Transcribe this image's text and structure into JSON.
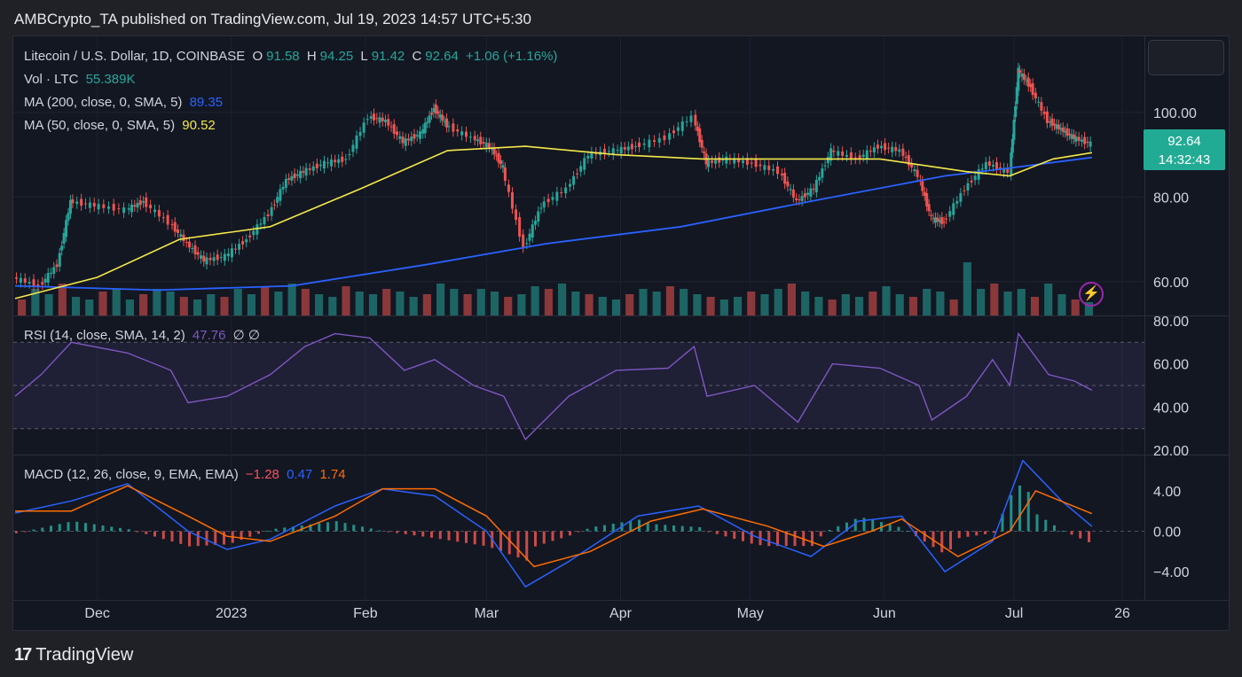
{
  "header": {
    "publisher_line": "AMBCrypto_TA published on TradingView.com, Jul 19, 2023 14:57 UTC+5:30"
  },
  "legend": {
    "symbol": "Litecoin / U.S. Dollar, 1D, COINBASE",
    "o_label": "O",
    "o_value": "91.58",
    "h_label": "H",
    "h_value": "94.25",
    "l_label": "L",
    "l_value": "91.42",
    "c_label": "C",
    "c_value": "92.64",
    "change": "+1.06 (+1.16%)",
    "vol_label": "Vol · LTC",
    "vol_value": "55.389K",
    "ma200_label": "MA (200, close, 0, SMA, 5)",
    "ma200_value": "89.35",
    "ma50_label": "MA (50, close, 0, SMA, 5)",
    "ma50_value": "90.52",
    "rsi_label": "RSI (14, close, SMA, 14, 2)",
    "rsi_value": "47.76",
    "rsi_extra": "∅ ∅",
    "macd_label": "MACD (12, 26, close, 9, EMA, EMA)",
    "macd_hist": "−1.28",
    "macd_value": "0.47",
    "macd_signal": "1.74"
  },
  "price_tag": {
    "price": "92.64",
    "countdown": "14:32:43"
  },
  "colors": {
    "up": "#26a69a",
    "down": "#ef5350",
    "ma200": "#2962ff",
    "ma50": "#f5e94a",
    "rsi": "#7e57c2",
    "macd": "#2962ff",
    "signal": "#ff6d00"
  },
  "footer": {
    "brand": "TradingView"
  },
  "chart_data": {
    "type": "line",
    "x_labels": [
      "Dec",
      "2023",
      "Feb",
      "Mar",
      "Apr",
      "May",
      "Jun",
      "Jul",
      "26"
    ],
    "price_axis": {
      "ticks": [
        "60.00",
        "80.00",
        "100.00"
      ],
      "ylim": [
        52,
        118
      ]
    },
    "rsi_axis": {
      "ticks": [
        "20.00",
        "40.00",
        "60.00",
        "80.00"
      ],
      "bands": [
        30,
        70
      ],
      "mid": 50
    },
    "macd_axis": {
      "ticks": [
        "−4.00",
        "0.00",
        "4.00"
      ]
    },
    "price_series": [
      [
        "2022-11-12",
        61
      ],
      [
        "2022-11-18",
        59
      ],
      [
        "2022-11-22",
        64
      ],
      [
        "2022-11-25",
        79
      ],
      [
        "2022-12-01",
        78
      ],
      [
        "2022-12-08",
        77
      ],
      [
        "2022-12-12",
        79
      ],
      [
        "2022-12-18",
        74
      ],
      [
        "2022-12-22",
        69
      ],
      [
        "2022-12-26",
        65
      ],
      [
        "2022-12-31",
        66
      ],
      [
        "2023-01-05",
        70
      ],
      [
        "2023-01-10",
        76
      ],
      [
        "2023-01-14",
        84
      ],
      [
        "2023-01-18",
        86
      ],
      [
        "2023-01-23",
        88
      ],
      [
        "2023-01-28",
        89
      ],
      [
        "2023-02-02",
        99
      ],
      [
        "2023-02-06",
        98
      ],
      [
        "2023-02-10",
        93
      ],
      [
        "2023-02-14",
        95
      ],
      [
        "2023-02-17",
        101
      ],
      [
        "2023-02-20",
        97
      ],
      [
        "2023-02-26",
        94
      ],
      [
        "2023-03-02",
        92
      ],
      [
        "2023-03-05",
        87
      ],
      [
        "2023-03-10",
        68
      ],
      [
        "2023-03-14",
        78
      ],
      [
        "2023-03-20",
        82
      ],
      [
        "2023-03-25",
        90
      ],
      [
        "2023-03-31",
        91
      ],
      [
        "2023-04-05",
        92
      ],
      [
        "2023-04-12",
        94
      ],
      [
        "2023-04-18",
        99
      ],
      [
        "2023-04-21",
        88
      ],
      [
        "2023-04-26",
        89
      ],
      [
        "2023-05-02",
        88
      ],
      [
        "2023-05-08",
        86
      ],
      [
        "2023-05-12",
        79
      ],
      [
        "2023-05-16",
        82
      ],
      [
        "2023-05-20",
        91
      ],
      [
        "2023-05-26",
        89
      ],
      [
        "2023-05-31",
        92
      ],
      [
        "2023-06-05",
        91
      ],
      [
        "2023-06-09",
        85
      ],
      [
        "2023-06-12",
        75
      ],
      [
        "2023-06-15",
        74
      ],
      [
        "2023-06-20",
        82
      ],
      [
        "2023-06-25",
        88
      ],
      [
        "2023-06-30",
        86
      ],
      [
        "2023-07-02",
        110
      ],
      [
        "2023-07-05",
        106
      ],
      [
        "2023-07-09",
        98
      ],
      [
        "2023-07-12",
        96
      ],
      [
        "2023-07-15",
        94
      ],
      [
        "2023-07-19",
        92.6
      ]
    ],
    "ma50_series": [
      [
        "2022-11-12",
        56
      ],
      [
        "2022-12-01",
        61
      ],
      [
        "2022-12-20",
        70
      ],
      [
        "2023-01-10",
        73
      ],
      [
        "2023-01-31",
        82
      ],
      [
        "2023-02-20",
        91
      ],
      [
        "2023-03-10",
        92
      ],
      [
        "2023-03-31",
        90
      ],
      [
        "2023-04-20",
        89
      ],
      [
        "2023-05-10",
        89
      ],
      [
        "2023-05-31",
        89
      ],
      [
        "2023-06-20",
        86
      ],
      [
        "2023-06-30",
        85
      ],
      [
        "2023-07-10",
        89
      ],
      [
        "2023-07-19",
        90.5
      ]
    ],
    "ma200_series": [
      [
        "2022-11-12",
        59
      ],
      [
        "2022-12-15",
        58
      ],
      [
        "2023-01-15",
        59
      ],
      [
        "2023-02-15",
        64
      ],
      [
        "2023-03-15",
        69
      ],
      [
        "2023-04-15",
        73
      ],
      [
        "2023-05-15",
        79
      ],
      [
        "2023-06-15",
        85
      ],
      [
        "2023-07-01",
        87
      ],
      [
        "2023-07-19",
        89.35
      ]
    ],
    "rsi_series": [
      [
        "2022-11-12",
        45
      ],
      [
        "2022-11-18",
        55
      ],
      [
        "2022-11-25",
        70
      ],
      [
        "2022-12-08",
        65
      ],
      [
        "2022-12-18",
        57
      ],
      [
        "2022-12-22",
        42
      ],
      [
        "2022-12-31",
        45
      ],
      [
        "2023-01-10",
        55
      ],
      [
        "2023-01-18",
        68
      ],
      [
        "2023-01-25",
        74
      ],
      [
        "2023-02-02",
        72
      ],
      [
        "2023-02-10",
        57
      ],
      [
        "2023-02-17",
        62
      ],
      [
        "2023-02-26",
        50
      ],
      [
        "2023-03-05",
        45
      ],
      [
        "2023-03-10",
        25
      ],
      [
        "2023-03-20",
        45
      ],
      [
        "2023-03-31",
        57
      ],
      [
        "2023-04-12",
        58
      ],
      [
        "2023-04-18",
        68
      ],
      [
        "2023-04-21",
        45
      ],
      [
        "2023-05-02",
        50
      ],
      [
        "2023-05-12",
        33
      ],
      [
        "2023-05-20",
        60
      ],
      [
        "2023-05-31",
        58
      ],
      [
        "2023-06-09",
        50
      ],
      [
        "2023-06-12",
        34
      ],
      [
        "2023-06-20",
        45
      ],
      [
        "2023-06-26",
        62
      ],
      [
        "2023-06-30",
        50
      ],
      [
        "2023-07-02",
        74
      ],
      [
        "2023-07-09",
        55
      ],
      [
        "2023-07-15",
        52
      ],
      [
        "2023-07-19",
        47.8
      ]
    ],
    "macd_series": [
      [
        "2022-11-12",
        1.8
      ],
      [
        "2022-11-25",
        3
      ],
      [
        "2022-12-08",
        4.7
      ],
      [
        "2022-12-22",
        0
      ],
      [
        "2022-12-31",
        -1.8
      ],
      [
        "2023-01-10",
        -0.8
      ],
      [
        "2023-01-25",
        2.5
      ],
      [
        "2023-02-05",
        4.2
      ],
      [
        "2023-02-17",
        3.5
      ],
      [
        "2023-03-01",
        0
      ],
      [
        "2023-03-10",
        -5.5
      ],
      [
        "2023-03-20",
        -3
      ],
      [
        "2023-04-05",
        1.5
      ],
      [
        "2023-04-19",
        2.5
      ],
      [
        "2023-05-02",
        -0.5
      ],
      [
        "2023-05-15",
        -2.5
      ],
      [
        "2023-05-26",
        1
      ],
      [
        "2023-06-05",
        1.5
      ],
      [
        "2023-06-15",
        -4
      ],
      [
        "2023-06-26",
        -1
      ],
      [
        "2023-07-03",
        7
      ],
      [
        "2023-07-12",
        3
      ],
      [
        "2023-07-19",
        0.47
      ]
    ],
    "signal_series": [
      [
        "2022-11-12",
        2
      ],
      [
        "2022-11-25",
        2
      ],
      [
        "2022-12-08",
        4.5
      ],
      [
        "2022-12-22",
        1.5
      ],
      [
        "2022-12-31",
        -0.5
      ],
      [
        "2023-01-10",
        -1
      ],
      [
        "2023-01-25",
        1.5
      ],
      [
        "2023-02-05",
        4.2
      ],
      [
        "2023-02-17",
        4.2
      ],
      [
        "2023-03-01",
        1.5
      ],
      [
        "2023-03-12",
        -3.5
      ],
      [
        "2023-03-25",
        -2
      ],
      [
        "2023-04-08",
        1
      ],
      [
        "2023-04-20",
        2.2
      ],
      [
        "2023-05-05",
        0.5
      ],
      [
        "2023-05-18",
        -1.5
      ],
      [
        "2023-05-29",
        0
      ],
      [
        "2023-06-05",
        1.2
      ],
      [
        "2023-06-18",
        -2.5
      ],
      [
        "2023-06-30",
        0
      ],
      [
        "2023-07-06",
        4
      ],
      [
        "2023-07-19",
        1.74
      ]
    ],
    "volume_relative": [
      0.3,
      0.5,
      0.4,
      0.6,
      0.35,
      0.3,
      0.45,
      0.5,
      0.3,
      0.4,
      0.5,
      0.45,
      0.35,
      0.3,
      0.4,
      0.35,
      0.5,
      0.4,
      0.55,
      0.45,
      0.6,
      0.5,
      0.4,
      0.35,
      0.55,
      0.45,
      0.4,
      0.5,
      0.45,
      0.35,
      0.4,
      0.6,
      0.5,
      0.4,
      0.5,
      0.45,
      0.35,
      0.4,
      0.55,
      0.5,
      0.6,
      0.45,
      0.4,
      0.35,
      0.3,
      0.4,
      0.5,
      0.45,
      0.55,
      0.5,
      0.4,
      0.35,
      0.3,
      0.35,
      0.45,
      0.4,
      0.5,
      0.6,
      0.45,
      0.35,
      0.3,
      0.4,
      0.35,
      0.45,
      0.55,
      0.4,
      0.35,
      0.5,
      0.45,
      0.3,
      1.0,
      0.5,
      0.6,
      0.45,
      0.5,
      0.35,
      0.6,
      0.4,
      0.3,
      0.25
    ]
  }
}
